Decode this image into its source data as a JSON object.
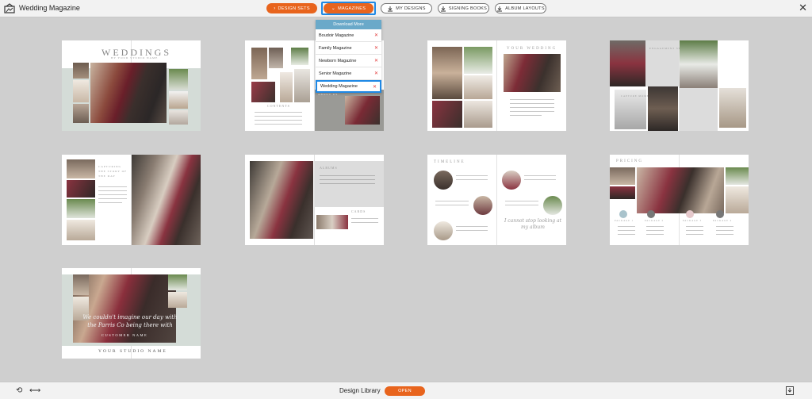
{
  "app": {
    "title": "Wedding Magazine"
  },
  "toolbar": {
    "design_sets": "DESIGN SETS",
    "magazines": "MAGAZINES",
    "my_designs": "MY DESIGNS",
    "signing_books": "SIGNING BOOKS",
    "album_layouts": "ALBUM LAYOUTS"
  },
  "dropdown": {
    "header": "Download More",
    "items": [
      {
        "label": "Boudoir Magazine"
      },
      {
        "label": "Family Magazine"
      },
      {
        "label": "Newborn Magazine"
      },
      {
        "label": "Senior Magazine"
      },
      {
        "label": "Wedding Magazine"
      }
    ]
  },
  "cards": {
    "c1": {
      "title": "WEDDINGS",
      "subtitle": "BY YOUR STUDIO NAME"
    },
    "c2": {
      "contents": "CONTENTS",
      "about": "ABOUT US"
    },
    "c3": {
      "title": "YOUR WEDDING"
    },
    "c4": {
      "label1": "ENGAGEMENT SESSIONS",
      "label2": "CAPTURE MOMENTS"
    },
    "c5": {
      "heading": "CAPTURING THE STORY OF THE DAY"
    },
    "c6": {
      "albums": "ALBUMS",
      "cards": "CARDS"
    },
    "c7": {
      "title": "TIMELINE",
      "quote": "I cannot stop looking at my album"
    },
    "c8": {
      "title": "PRICING",
      "p1": "PACKAGE 1",
      "p2": "PACKAGE 2",
      "p3": "PACKAGE 3",
      "p4": "PACKAGE 4"
    },
    "c9": {
      "quote_line1": "We couldn't imagine our day with",
      "quote_line2": "the Parris Co being there with",
      "customer": "CUSTOMER NAME",
      "studio": "YOUR STUDIO NAME"
    }
  },
  "bottom": {
    "label": "Design Library",
    "open": "OPEN"
  }
}
